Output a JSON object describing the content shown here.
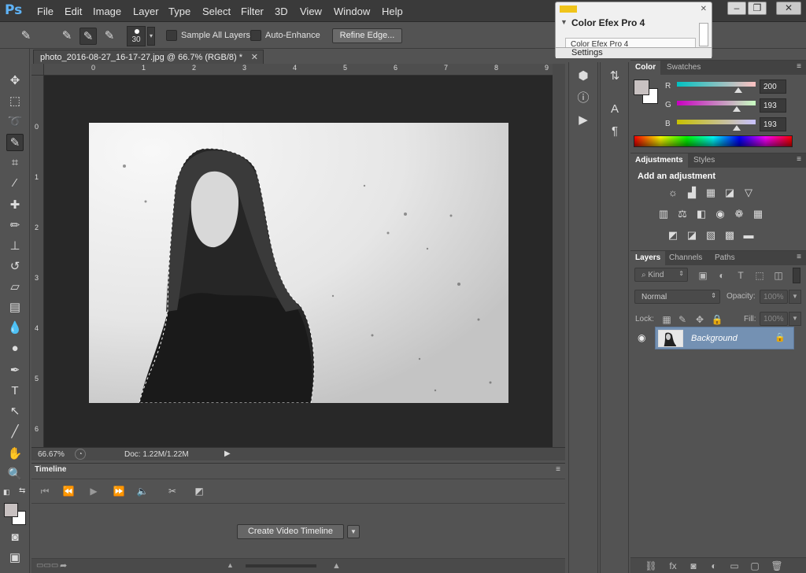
{
  "app": {
    "logo": "Ps",
    "menu": [
      "File",
      "Edit",
      "Image",
      "Layer",
      "Type",
      "Select",
      "Filter",
      "3D",
      "View",
      "Window",
      "Help"
    ],
    "window_buttons": {
      "minimize": "–",
      "restore": "❐",
      "close": "✕"
    }
  },
  "options_bar": {
    "brush_size": "30",
    "sample_all_layers": "Sample All Layers",
    "auto_enhance": "Auto-Enhance",
    "refine_edge": "Refine Edge..."
  },
  "color_efex": {
    "title": "Color Efex Pro 4",
    "subtitle": "Color Efex Pro 4",
    "settings": "Settings"
  },
  "document": {
    "tab_title": "photo_2016-08-27_16-17-27.jpg @ 66.7% (RGB/8) *",
    "zoom": "66.67%",
    "doc_size": "Doc: 1.22M/1.22M",
    "ruler_top_ticks": [
      "0",
      "1",
      "2",
      "3",
      "4",
      "5",
      "6",
      "7",
      "8",
      "9"
    ],
    "ruler_left_ticks": [
      "0",
      "1",
      "2",
      "3",
      "4",
      "5",
      "6"
    ]
  },
  "timeline": {
    "title": "Timeline",
    "create_button": "Create Video Timeline"
  },
  "color_panel": {
    "tabs": [
      "Color",
      "Swatches"
    ],
    "channels": [
      {
        "label": "R",
        "value": "200",
        "level": 200,
        "track": "linear-gradient(to right,#00c1c1,#ffc1c1)"
      },
      {
        "label": "G",
        "value": "193",
        "level": 193,
        "track": "linear-gradient(to right,#c800c1,#c8ffc1)"
      },
      {
        "label": "B",
        "value": "193",
        "level": 193,
        "track": "linear-gradient(to right,#c8c100,#c8c1ff)"
      }
    ],
    "foreground": "#c8c1c1",
    "background": "#ffffff"
  },
  "adjustments_panel": {
    "tabs": [
      "Adjustments",
      "Styles"
    ],
    "heading": "Add an adjustment"
  },
  "layers_panel": {
    "tabs": [
      "Layers",
      "Channels",
      "Paths"
    ],
    "kind": "Kind",
    "blend_mode": "Normal",
    "opacity_label": "Opacity:",
    "opacity_value": "100%",
    "lock_label": "Lock:",
    "fill_label": "Fill:",
    "fill_value": "100%",
    "layer_name": "Background"
  }
}
